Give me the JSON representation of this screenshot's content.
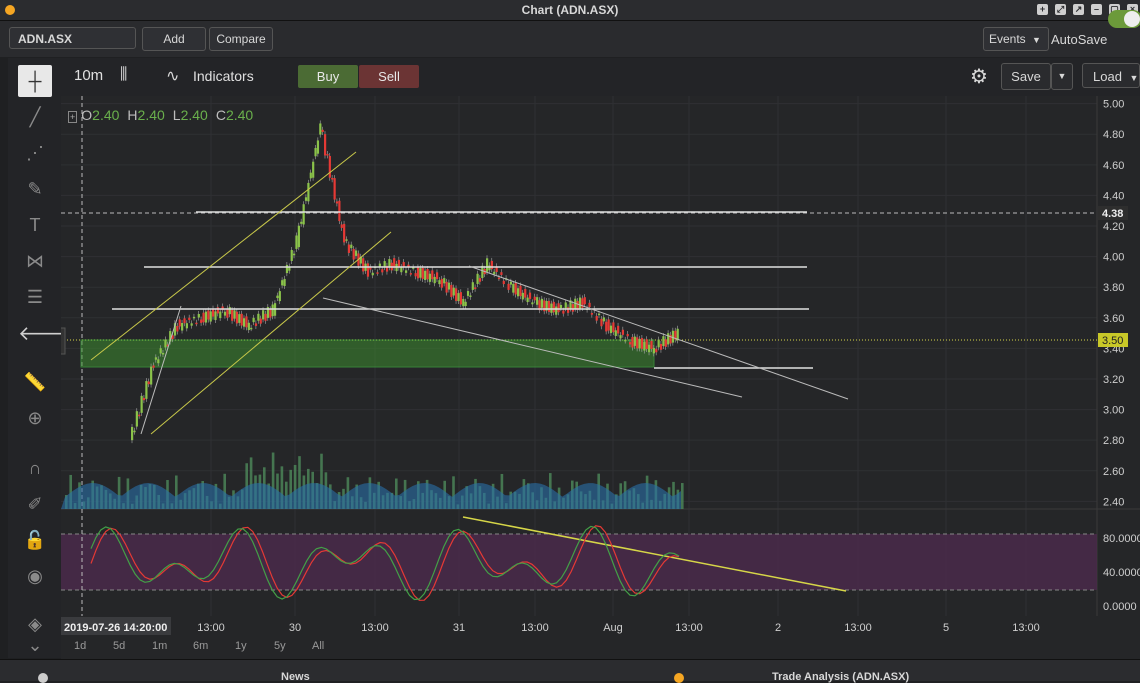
{
  "window": {
    "title": "Chart (ADN.ASX)"
  },
  "toolbar": {
    "symbol": "ADN.ASX",
    "add_label": "Add",
    "compare_label": "Compare",
    "events_label": "Events",
    "autosave_label": "AutoSave",
    "autosave_on": true
  },
  "chart_header": {
    "interval": "10m",
    "indicators_label": "Indicators",
    "buy_label": "Buy",
    "sell_label": "Sell",
    "save_label": "Save",
    "load_label": "Load"
  },
  "ohlc": {
    "o_label": "O",
    "o": "2.40",
    "h_label": "H",
    "h": "2.40",
    "l_label": "L",
    "l": "2.40",
    "c_label": "C",
    "c": "2.40"
  },
  "price_axis": {
    "ticks": [
      "5.00",
      "4.80",
      "4.60",
      "4.40",
      "4.20",
      "4.00",
      "3.80",
      "3.60",
      "3.40",
      "3.20",
      "3.00",
      "2.80",
      "2.60",
      "2.40"
    ],
    "marker_high": "4.38",
    "marker_last": "3.50"
  },
  "oscillator_axis": {
    "ticks": [
      "80.0000",
      "40.0000",
      "0.0000"
    ]
  },
  "time_axis": {
    "cursor_label": "2019-07-26 14:20:00",
    "ticks": [
      "13:00",
      "30",
      "13:00",
      "31",
      "13:00",
      "Aug",
      "13:00",
      "2",
      "13:00",
      "5",
      "13:00"
    ]
  },
  "range_buttons": [
    "1d",
    "5d",
    "1m",
    "6m",
    "1y",
    "5y",
    "All"
  ],
  "bottom_panels": {
    "news": "News",
    "trade_analysis": "Trade Analysis (ADN.ASX)"
  },
  "colors": {
    "up": "#8bc34a",
    "down": "#e53935",
    "accent_green": "#6c9a3a",
    "oscillator_band": "#4a2a4a",
    "trendline": "#c8c84a"
  },
  "chart_data": {
    "type": "line",
    "price_range": [
      2.35,
      5.05
    ],
    "price_series_approx": [
      2.8,
      3.3,
      3.55,
      3.6,
      3.65,
      3.55,
      3.65,
      4.1,
      4.85,
      4.1,
      3.9,
      3.95,
      3.9,
      3.85,
      3.7,
      3.95,
      3.8,
      3.7,
      3.65,
      3.7,
      3.55,
      3.45,
      3.4,
      3.5
    ],
    "horizontal_lines": [
      4.38,
      4.0,
      3.71,
      3.3
    ],
    "zone": [
      3.32,
      3.5
    ],
    "last_price": 3.5,
    "oscillator_range": [
      0,
      100
    ],
    "oscillator_levels": [
      80,
      20
    ]
  }
}
